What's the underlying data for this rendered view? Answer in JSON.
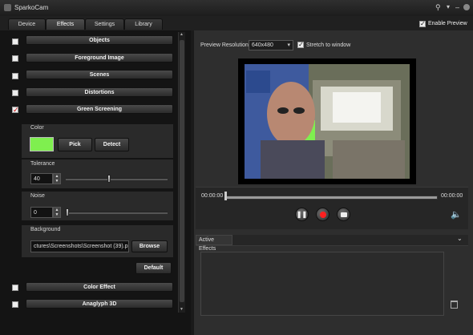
{
  "app": {
    "title": "SparkoCam"
  },
  "window_controls": [
    "pin-icon",
    "dropdown-icon",
    "minimize-icon",
    "close-icon"
  ],
  "tabs": [
    {
      "label": "Device"
    },
    {
      "label": "Effects",
      "active": true
    },
    {
      "label": "Settings"
    },
    {
      "label": "Library"
    }
  ],
  "enable_preview": {
    "label": "Enable Preview",
    "checked": true
  },
  "effects_list": [
    {
      "label": "Objects",
      "checked": false
    },
    {
      "label": "Foreground Image",
      "checked": false
    },
    {
      "label": "Scenes",
      "checked": false
    },
    {
      "label": "Distortions",
      "checked": false
    },
    {
      "label": "Green Screening",
      "checked": true
    }
  ],
  "green_screening": {
    "color_label": "Color",
    "color_swatch": "#7fef4f",
    "pick_label": "Pick",
    "detect_label": "Detect",
    "tolerance_label": "Tolerance",
    "tolerance_value": "40",
    "tolerance_level": 40,
    "noise_label": "Noise",
    "noise_value": "0",
    "noise_level": 0,
    "background_label": "Background",
    "background_path": "ctures\\Screenshots\\Screenshot (39).png",
    "browse_label": "Browse",
    "default_label": "Default"
  },
  "effects_list_bottom": [
    {
      "label": "Color Effect",
      "checked": false
    },
    {
      "label": "Anaglyph 3D",
      "checked": false
    }
  ],
  "preview": {
    "resolution_label": "Preview Resolution:",
    "resolution_value": "640x480",
    "stretch_label": "Stretch to window",
    "stretch_checked": true
  },
  "player": {
    "time_start": "00:00:00",
    "time_end": "00:00:00",
    "buttons": [
      "pause-icon",
      "record-icon",
      "snapshot-icon",
      "volume-icon"
    ]
  },
  "active_effects": {
    "label": "Active Effects"
  }
}
